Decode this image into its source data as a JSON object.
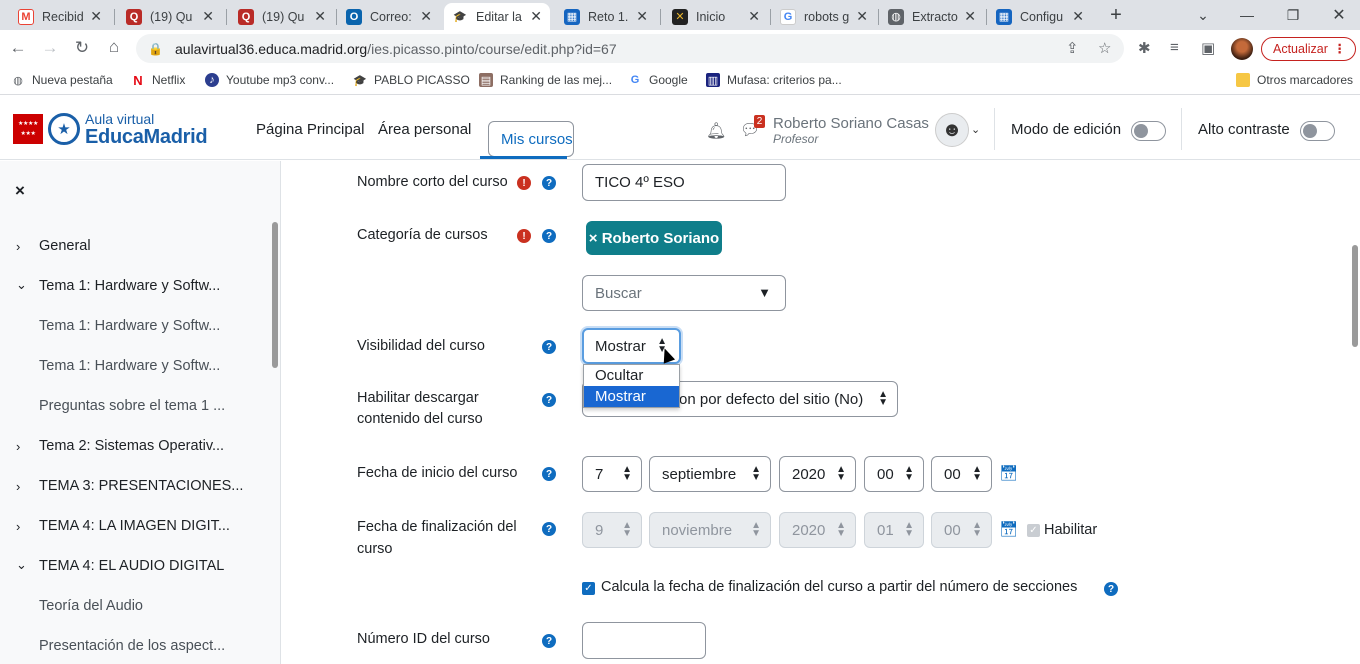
{
  "browser": {
    "tabs": [
      {
        "title": "Recibido",
        "icon": "gmail-icon"
      },
      {
        "title": "(19) Qu",
        "icon": "quora-icon"
      },
      {
        "title": "(19) Qu",
        "icon": "quora-icon"
      },
      {
        "title": "Correo:",
        "icon": "outlook-icon"
      },
      {
        "title": "Editar la",
        "icon": "moodle-icon"
      },
      {
        "title": "Reto 1.",
        "icon": "clapper-icon"
      },
      {
        "title": "Inicio",
        "icon": "app-icon"
      },
      {
        "title": "robots g",
        "icon": "google-icon"
      },
      {
        "title": "Extracto",
        "icon": "globe-icon"
      },
      {
        "title": "Configu",
        "icon": "clapper-icon"
      }
    ],
    "new_tab": "+",
    "url_host": "aulavirtual36.educa.madrid.org",
    "url_path": "/ies.picasso.pinto/course/edit.php?id=67",
    "update_label": "Actualizar",
    "bookmarks": [
      "Nueva pestaña",
      "Netflix",
      "Youtube mp3 conv...",
      "PABLO PICASSO",
      "Ranking de las mej...",
      "Google",
      "Mufasa: criterios pa..."
    ],
    "other_bookmarks": "Otros marcadores"
  },
  "site": {
    "logo_small": "Aula virtual",
    "logo_big": "EducaMadrid",
    "nav": [
      "Página Principal",
      "Área personal",
      "Mis cursos"
    ],
    "message_badge": "2",
    "user_name": "Roberto Soriano Casas",
    "user_role": "Profesor",
    "edit_mode": "Modo de edición",
    "high_contrast": "Alto contraste"
  },
  "drawer": {
    "close": "×",
    "items": [
      {
        "label": "General",
        "level": "section",
        "chevron": "›"
      },
      {
        "label": "Tema 1: Hardware y Softw...",
        "level": "section",
        "chevron": "⌄"
      },
      {
        "label": "Tema 1: Hardware y Softw...",
        "level": "sub"
      },
      {
        "label": "Tema 1: Hardware y Softw...",
        "level": "sub"
      },
      {
        "label": "Preguntas sobre el tema 1 ...",
        "level": "sub"
      },
      {
        "label": "Tema 2: Sistemas Operativ...",
        "level": "section",
        "chevron": "›"
      },
      {
        "label": "TEMA 3: PRESENTACIONES...",
        "level": "section",
        "chevron": "›"
      },
      {
        "label": "TEMA 4: LA IMAGEN DIGIT...",
        "level": "section",
        "chevron": "›"
      },
      {
        "label": "TEMA 4: EL AUDIO DIGITAL",
        "level": "section",
        "chevron": "⌄"
      },
      {
        "label": "Teoría del Audio",
        "level": "sub"
      },
      {
        "label": "Presentación de los aspect...",
        "level": "sub"
      }
    ]
  },
  "form": {
    "short_name_label": "Nombre corto del curso",
    "short_name_value": "TICO 4º ESO",
    "category_label": "Categoría de cursos",
    "category_chip": "× Roberto Soriano",
    "search_placeholder": "Buscar",
    "visibility_label": "Visibilidad del curso",
    "visibility_value": "Mostrar",
    "visibility_options": [
      "Ocultar",
      "Mostrar"
    ],
    "download_label_1": "Habilitar descargar",
    "download_label_2": "contenido del curso",
    "download_value_tail": "on por defecto del sitio (No)",
    "start_label": "Fecha de inicio del curso",
    "start": {
      "day": "7",
      "month": "septiembre",
      "year": "2020",
      "hour": "00",
      "minute": "00"
    },
    "end_label_1": "Fecha de finalización del",
    "end_label_2": "curso",
    "end": {
      "day": "9",
      "month": "noviembre",
      "year": "2020",
      "hour": "01",
      "minute": "00"
    },
    "enable_label": "Habilitar",
    "calc_label": "Calcula la fecha de finalización del curso a partir del número de secciones",
    "id_label": "Número ID del curso",
    "id_value": ""
  },
  "colors": {
    "accent": "#0f6cbf",
    "chip": "#0f7e8a",
    "required": "#ca3120"
  }
}
